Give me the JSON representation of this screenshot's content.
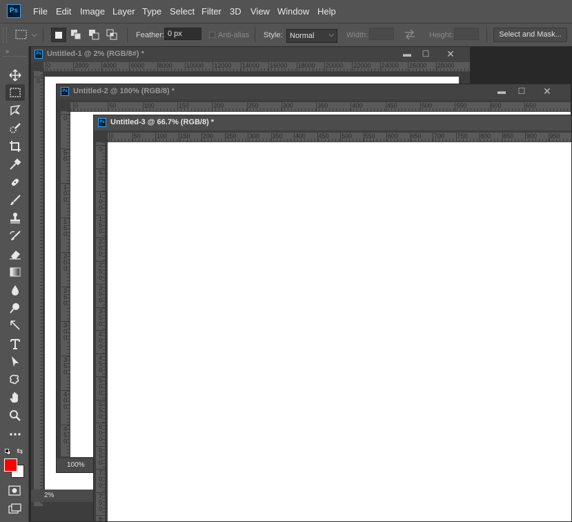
{
  "app": {
    "logo": "Ps"
  },
  "menu": [
    "File",
    "Edit",
    "Image",
    "Layer",
    "Type",
    "Select",
    "Filter",
    "3D",
    "View",
    "Window",
    "Help"
  ],
  "options": {
    "feather_label": "Feather:",
    "feather_value": "0 px",
    "antialias_label": "Anti-alias",
    "style_label": "Style:",
    "style_value": "Normal",
    "width_label": "Width:",
    "height_label": "Height:",
    "select_mask_label": "Select and Mask..."
  },
  "tools": [
    "move-tool",
    "rectangular-marquee-tool",
    "lasso-tool",
    "quick-selection-tool",
    "crop-tool",
    "eyedropper-tool",
    "healing-brush-tool",
    "brush-tool",
    "clone-stamp-tool",
    "history-brush-tool",
    "eraser-tool",
    "gradient-tool",
    "blur-tool",
    "dodge-tool",
    "pen-tool",
    "type-tool",
    "path-selection-tool",
    "custom-shape-tool",
    "hand-tool",
    "zoom-tool",
    "more-tools"
  ],
  "colors": {
    "foreground": "#ff0000",
    "background": "#ffffff",
    "accent": "#31a8ff"
  },
  "windows": [
    {
      "title": "Untitled-1 @ 2% (RGB/8#) *",
      "zoom": "2%",
      "hruler": [
        "0",
        "2000",
        "4000",
        "6000",
        "8000",
        "10000",
        "12000",
        "14000",
        "16000",
        "18000",
        "20000",
        "22000",
        "24000",
        "26000",
        "28000"
      ],
      "vruler": [
        "0"
      ]
    },
    {
      "title": "Untitled-2 @ 100% (RGB/8) *",
      "zoom": "100%",
      "hruler": [
        "0",
        "50",
        "100",
        "150",
        "200",
        "250",
        "300",
        "350",
        "400",
        "450",
        "500",
        "550",
        "600",
        "650"
      ],
      "vruler": [
        "0",
        "50",
        "100",
        "150",
        "200",
        "250",
        "300",
        "350",
        "400",
        "450"
      ]
    },
    {
      "title": "Untitled-3 @ 66.7% (RGB/8) *",
      "hruler": [
        "0",
        "50",
        "100",
        "150",
        "200",
        "250",
        "300",
        "350",
        "400",
        "450",
        "500",
        "550",
        "600",
        "650",
        "700",
        "750",
        "800",
        "850",
        "900",
        "950"
      ],
      "vruler": [
        "0",
        "50",
        "100",
        "150",
        "200",
        "250",
        "300",
        "350",
        "400",
        "450",
        "500",
        "550",
        "600",
        "650",
        "700",
        "750",
        "800"
      ]
    }
  ]
}
